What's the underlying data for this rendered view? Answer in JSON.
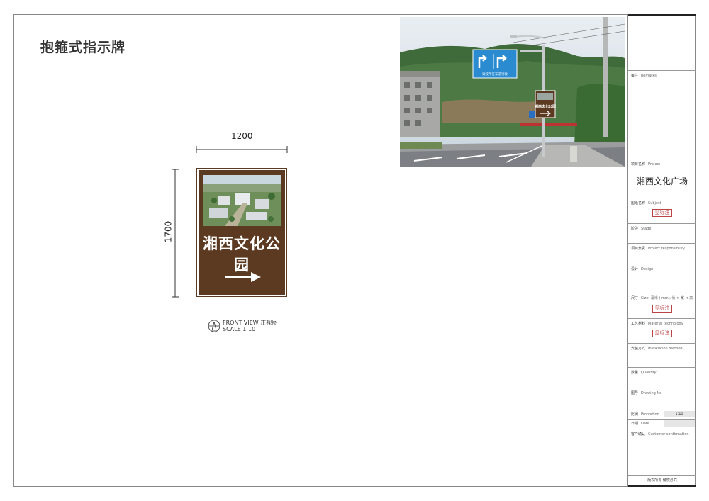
{
  "drawing_title": "抱箍式指示牌",
  "dimensions": {
    "width": "1200",
    "height": "1700"
  },
  "sign": {
    "name": "湘西文化公园",
    "arrow": "right-arrow-icon",
    "panel_color": "#5c3a21"
  },
  "view": {
    "view_en": "FRONT VIEW",
    "view_cn": "正视图",
    "scale": "SCALE 1:10"
  },
  "title_block": {
    "remarks": {
      "cn": "备注",
      "en": "Remarks"
    },
    "project": {
      "cn": "项目名称",
      "en": "Project",
      "value": "湘西文化广场"
    },
    "subject": {
      "cn": "图纸名称",
      "en": "Subject",
      "stamp": "见标注"
    },
    "stage": {
      "cn": "阶段",
      "en": "Stage"
    },
    "responsibility": {
      "cn": "项目负责",
      "en": "Project responsibility"
    },
    "design": {
      "cn": "设计",
      "en": "Design"
    },
    "size": {
      "cn": "尺寸",
      "en": "Size( 毫米 ) mm ; 长 × 宽 × 高",
      "stamp": "见标注"
    },
    "material": {
      "cn": "工艺材料",
      "en": "Material technology",
      "stamp": "见标注"
    },
    "installation": {
      "cn": "安装方式",
      "en": "Installation method"
    },
    "quantity": {
      "cn": "数量",
      "en": "Quantity"
    },
    "drawing_no": {
      "cn": "图号",
      "en": "Drawing No"
    },
    "proportion": {
      "cn": "比例",
      "en": "Proportion",
      "value": "1:10"
    },
    "date": {
      "cn": "日期",
      "en": "Date"
    },
    "customer": {
      "cn": "客户确认",
      "en": "Customer confirmation"
    },
    "copyright": "版权所有  侵权必究"
  },
  "photo_sign": {
    "name": "湘西文化公园",
    "road_sign_caption": "请按所在车道行驶"
  }
}
